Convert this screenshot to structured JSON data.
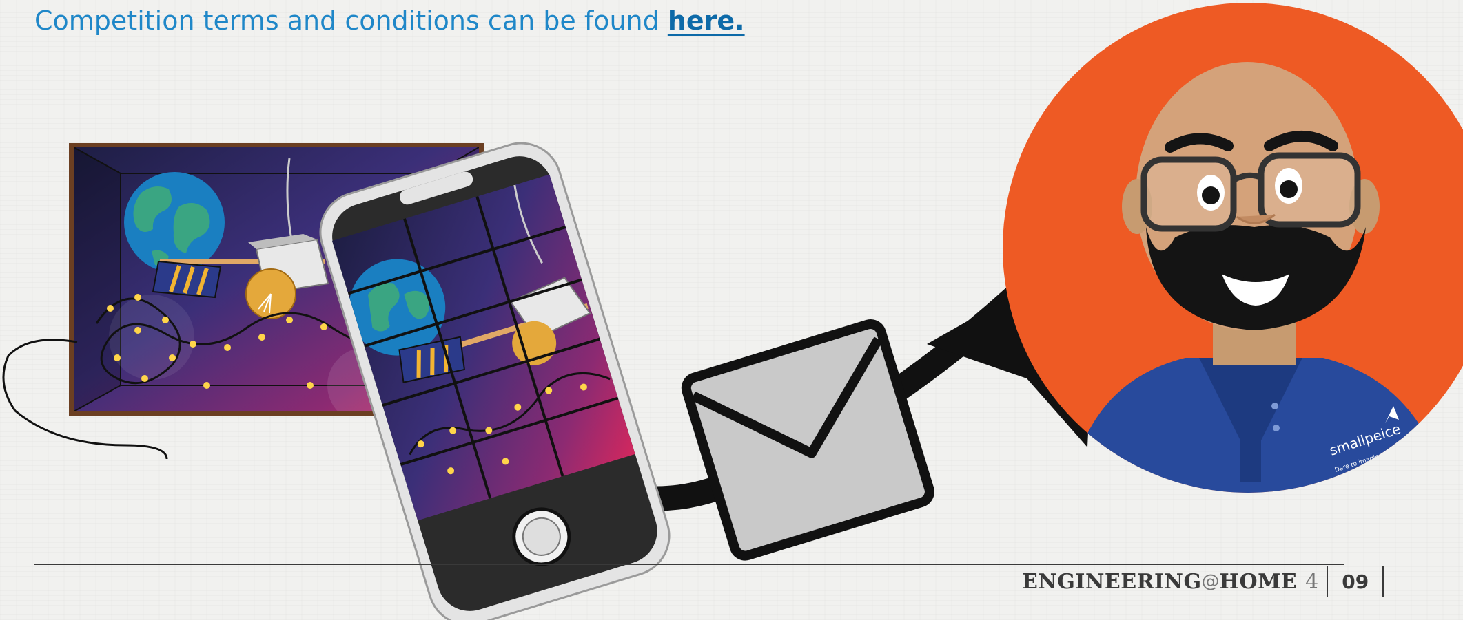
{
  "header": {
    "terms_text": "Competition terms and conditions can be found ",
    "terms_link": "here."
  },
  "footer": {
    "brand_part1": "ENGINEERING",
    "brand_at": "@",
    "brand_part2": "HOME",
    "issue_number": "4",
    "page_number": "09"
  },
  "illustration": {
    "shirt_logo_text": "smallpeice",
    "shirt_logo_tagline": "Dare to imagine",
    "colors": {
      "link": "#1f87c8",
      "avatar_background": "#ee5a24",
      "shirt": "#284a9c",
      "envelope": "#c9c9c9"
    }
  }
}
